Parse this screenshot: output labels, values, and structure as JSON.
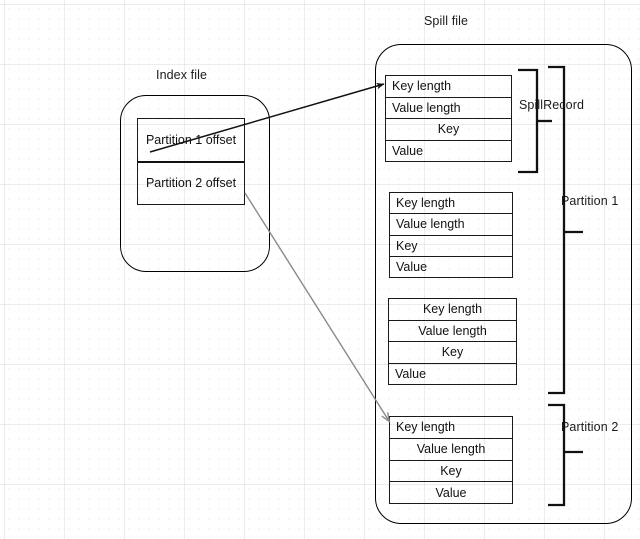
{
  "diagram": {
    "title_index": "Index file",
    "title_spill": "Spill file",
    "index_file": {
      "rows": [
        {
          "label": "Partition 1 offset"
        },
        {
          "label": "Partition 2 offset"
        }
      ]
    },
    "spill_file": {
      "record_fields": [
        "Key length",
        "Value length",
        "Key",
        "Value"
      ],
      "records": [
        {
          "id": "record-1",
          "fields": [
            "Key length",
            "Value length",
            "Key",
            "Value"
          ]
        },
        {
          "id": "record-2",
          "fields": [
            "Key length",
            "Value length",
            "Key",
            "Value"
          ]
        },
        {
          "id": "record-3",
          "fields": [
            "Key length",
            "Value length",
            "Key",
            "Value"
          ]
        },
        {
          "id": "record-4",
          "fields": [
            "Key length",
            "Value length",
            "Key",
            "Value"
          ]
        }
      ],
      "brackets": [
        {
          "id": "spill-record",
          "label": "SpillRecord"
        },
        {
          "id": "partition-1",
          "label": "Partition 1"
        },
        {
          "id": "partition-2",
          "label": "Partition 2"
        }
      ]
    },
    "connectors": [
      {
        "id": "arrow-partition-1",
        "from": "Partition 1 offset",
        "to": "record-1",
        "color": "#1a1a1a"
      },
      {
        "id": "arrow-partition-2",
        "from": "Partition 2 offset",
        "to": "record-4",
        "color": "#8a8a8a"
      }
    ]
  }
}
